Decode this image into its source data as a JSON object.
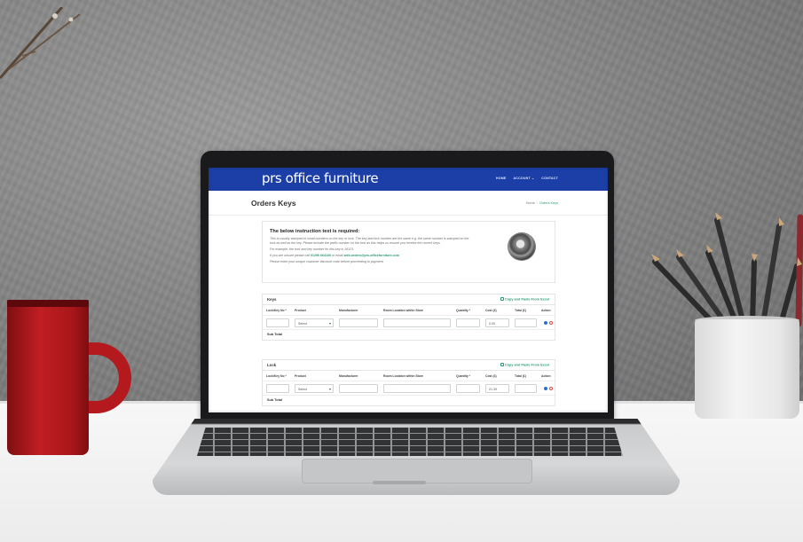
{
  "site": {
    "logo_text": "prs office furniture",
    "brand_color": "#1b3fa6",
    "accent_color": "#2a9a76",
    "nav": [
      "HOME",
      "ACCOUNT",
      "CONTACT"
    ]
  },
  "page": {
    "title": "Orders Keys",
    "breadcrumb": {
      "home": "Home",
      "separator": "/",
      "current": "Orders Keys"
    }
  },
  "instructions": {
    "heading": "The below instruction text is required:",
    "line1": "This is usually stamped in small numbers on the key or lock. The key and lock number are the same e.g. the same number is stamped on the",
    "line2": "lock as well as the key. Please include the prefix number on the lock as this helps us ensure you receive the correct keys.",
    "line3": "For example, the lock and key number for this key is 16123.",
    "line4_prefix": "If you are unsure please call",
    "phone": "01296 664100",
    "line4_mid": "or email",
    "email": "web.orders@prs-officefurniture.com",
    "line5": "Please enter your unique customer discount code before proceeding to payment.",
    "image_icon": "lock-key-image"
  },
  "keys_section": {
    "name": "Keys",
    "paste_button": "Copy and Paste From Excel",
    "columns": [
      "Lock/Key No *",
      "Product",
      "Manufacturer",
      "Room Location within Store",
      "Quantity *",
      "Cost (£)",
      "Total (£)",
      "Action"
    ],
    "row": {
      "lock_no": "",
      "product": "Select",
      "manufacturer": "",
      "room": "",
      "quantity": "",
      "cost": "0.00",
      "total": ""
    },
    "subtotal_label": "Sub Total"
  },
  "lock_section": {
    "name": "Lock",
    "paste_button": "Copy and Paste From Excel",
    "columns": [
      "Lock/Key No *",
      "Product",
      "Manufacturer",
      "Room Location within Store",
      "Quantity *",
      "Cost (£)",
      "Total (£)",
      "Action"
    ],
    "row": {
      "lock_no": "",
      "product": "Select",
      "manufacturer": "",
      "room": "",
      "quantity": "",
      "cost": "21.39",
      "total": ""
    },
    "subtotal_label": "Sub Total"
  }
}
